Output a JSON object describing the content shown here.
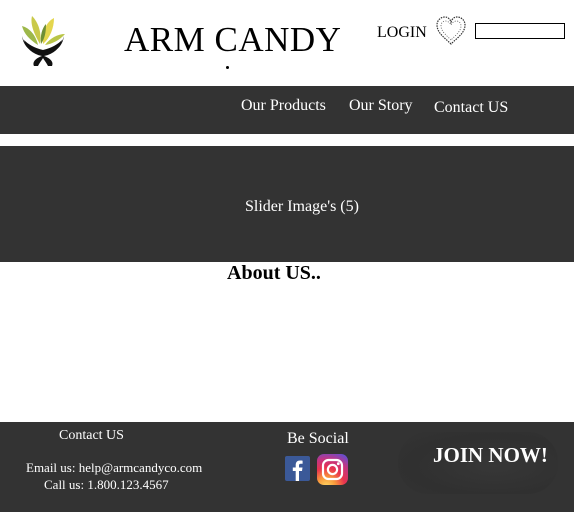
{
  "header": {
    "brand": "ARM CANDY",
    "login_label": "LOGIN",
    "search_value": ""
  },
  "nav": {
    "items": [
      {
        "label": "Our Products"
      },
      {
        "label": "Our Story"
      },
      {
        "label": "Contact US"
      }
    ]
  },
  "slider": {
    "text": "Slider Image's (5)"
  },
  "about": {
    "title": "About US.."
  },
  "footer": {
    "contact_title": "Contact US",
    "email": "Email us: help@armcandyco.com",
    "phone": "Call us: 1.800.123.4567",
    "social_title": "Be Social",
    "join_label": "JOIN NOW!"
  },
  "colors": {
    "bar_background": "#333333",
    "text_light": "#ffffff",
    "facebook_blue": "#3b5998"
  },
  "icons": [
    "leaf-hands-logo",
    "heart-icon",
    "facebook-icon",
    "instagram-icon"
  ]
}
